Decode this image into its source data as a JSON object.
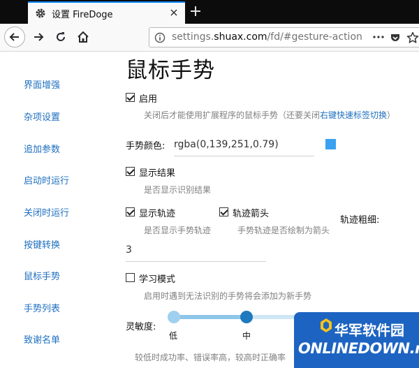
{
  "browser": {
    "tab_title": "设置 FireDoge",
    "url_prefix": "settings.",
    "url_domain": "shuax.com",
    "url_path": "/fd/#gesture-action"
  },
  "sidebar": {
    "items": [
      {
        "label": "界面增强"
      },
      {
        "label": "杂项设置"
      },
      {
        "label": "追加参数"
      },
      {
        "label": "启动时运行"
      },
      {
        "label": "关闭时运行"
      },
      {
        "label": "按键转换"
      },
      {
        "label": "鼠标手势"
      },
      {
        "label": "手势列表"
      },
      {
        "label": "致谢名单"
      }
    ]
  },
  "main": {
    "title": "鼠标手势",
    "enable": {
      "label": "启用",
      "checked": true,
      "hint_prefix": "关闭后才能使用扩展程序的鼠标手势（还要关闭",
      "hint_link": "右键快速标签切换",
      "hint_suffix": "）"
    },
    "gesture_color": {
      "label": "手势颜色:",
      "value": "rgba(0,139,251,0.79)",
      "swatch": "#3aa2f0"
    },
    "show_result": {
      "label": "显示结果",
      "checked": true,
      "hint": "是否显示识别结果"
    },
    "show_trail": {
      "label": "显示轨迹",
      "checked": true,
      "hint": "是否显示手势轨迹"
    },
    "trail_arrow": {
      "label": "轨迹箭头",
      "checked": true,
      "hint": "手势轨迹是否绘制为箭头"
    },
    "trail_width": {
      "label": "轨迹粗细:",
      "value": "3"
    },
    "learn_mode": {
      "label": "学习模式",
      "checked": false,
      "hint": "启用时遇到无法识别的手势将会添加为新手势"
    },
    "sensitivity": {
      "label": "灵敏度:",
      "low": "低",
      "mid": "中",
      "selected_level": "中",
      "hint": "较低时成功率、错误率高，较高时正确率"
    }
  },
  "watermark": {
    "cn": "华军软件园",
    "en": "ONLINEDOWN.net"
  },
  "colors": {
    "accent": "#0a84ff",
    "link": "#1e6fbf",
    "slider_active": "#1f79bd"
  }
}
